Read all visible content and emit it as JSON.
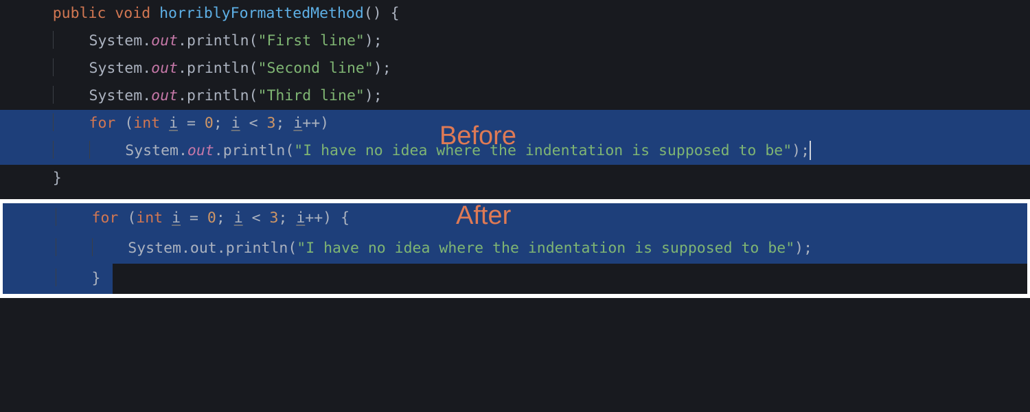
{
  "labels": {
    "before": "Before",
    "after": "After"
  },
  "before": {
    "l1": {
      "kw1": "public",
      "kw2": "void",
      "fn": "horriblyFormattedMethod",
      "paren": "() {"
    },
    "print1": {
      "sys": "System",
      "out": "out",
      "call": "println",
      "arg": "\"First line\""
    },
    "print2": {
      "sys": "System",
      "out": "out",
      "call": "println",
      "arg": "\"Second line\""
    },
    "print3": {
      "sys": "System",
      "out": "out",
      "call": "println",
      "arg": "\"Third line\""
    },
    "for": {
      "kw": "for",
      "int": "int",
      "i1": "i",
      "eq": " = ",
      "zero": "0",
      "sep1": "; ",
      "i2": "i",
      "lt": " < ",
      "three": "3",
      "sep2": "; ",
      "i3": "i",
      "inc": "++)"
    },
    "print4": {
      "sys": "System",
      "out": "out",
      "call": "println",
      "arg": "\"I have no idea where the indentation is supposed to be\""
    },
    "close": "}"
  },
  "after": {
    "for": {
      "kw": "for",
      "int": "int",
      "i1": "i",
      "eq": " = ",
      "zero": "0",
      "sep1": "; ",
      "i2": "i",
      "lt": " < ",
      "three": "3",
      "sep2": "; ",
      "i3": "i",
      "inc": "++) {"
    },
    "print": {
      "sys": "System",
      "out": "out",
      "call": "println",
      "arg": "\"I have no idea where the indentation is supposed to be\""
    },
    "close": "}"
  }
}
